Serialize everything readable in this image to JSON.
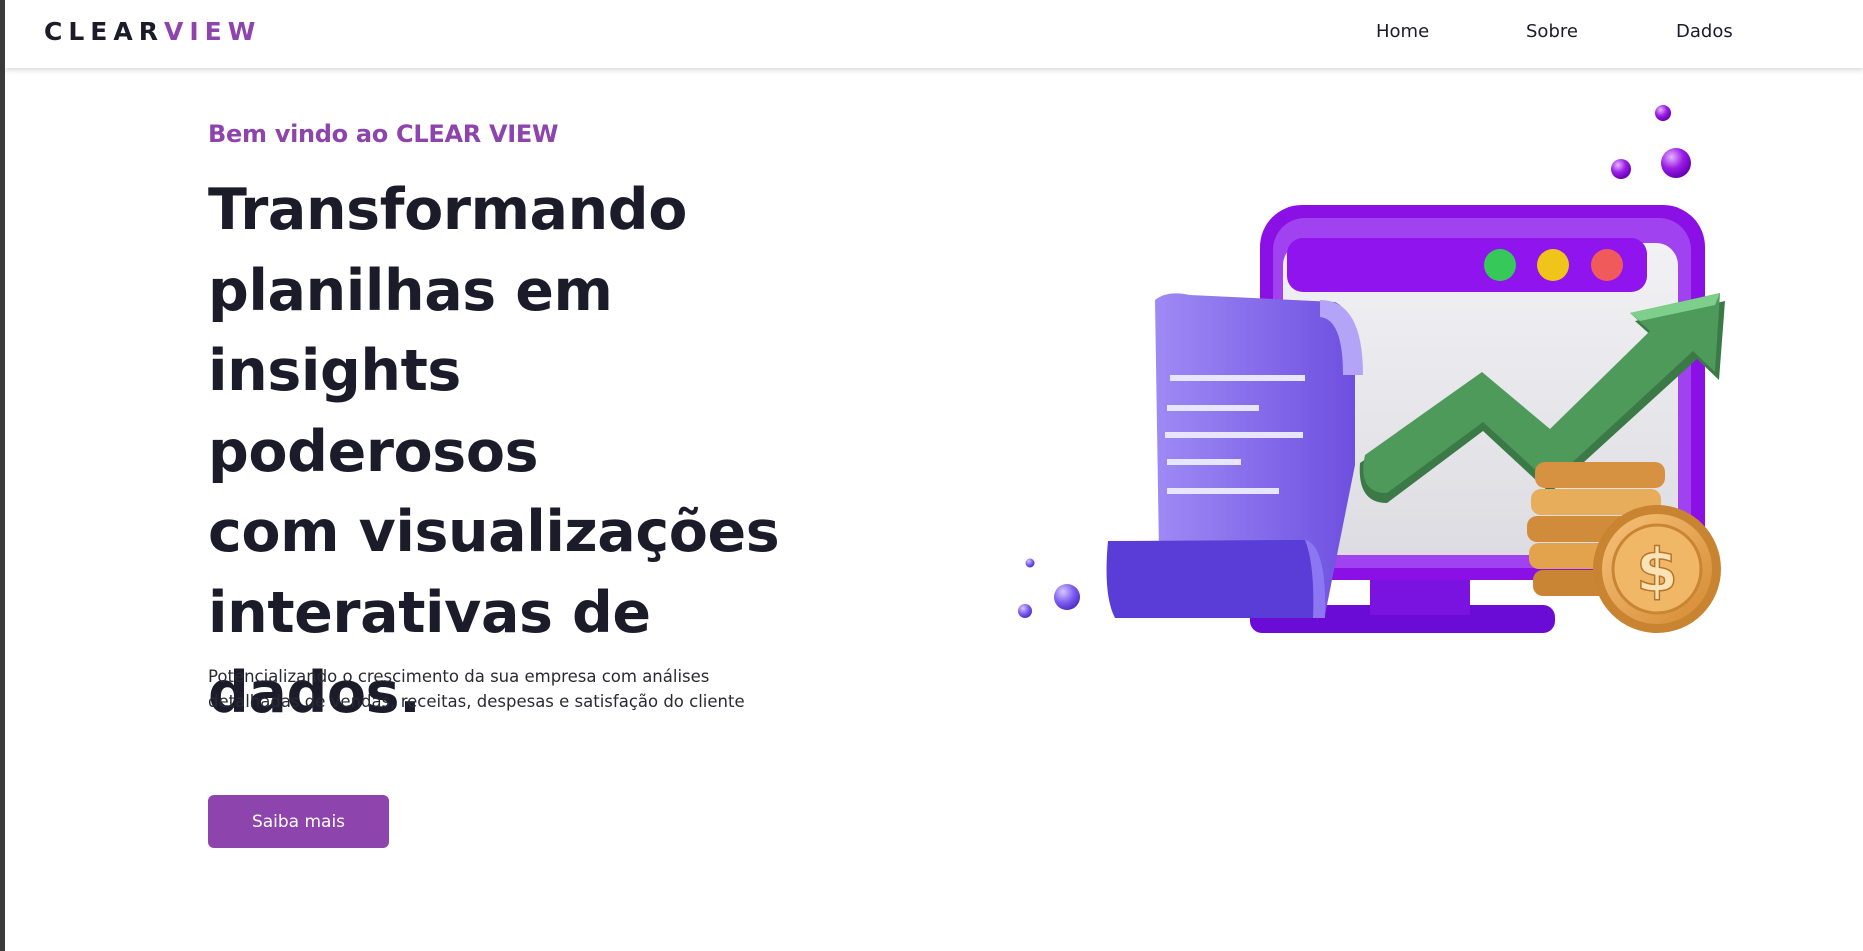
{
  "header": {
    "logo_main": "CLEAR",
    "logo_accent": "VIEW",
    "nav": [
      "Home",
      "Sobre",
      "Dados"
    ]
  },
  "hero": {
    "subtitle": "Bem vindo ao CLEAR VIEW",
    "title_lines": [
      "Transformando",
      "planilhas em",
      "insights poderosos",
      "com visualizações",
      "interativas de",
      "dados."
    ],
    "description_lines": [
      "Potencializando o crescimento da sua empresa com análises",
      "detalhadas de vendas, receitas, despesas e satisfação do cliente"
    ],
    "cta_label": "Saiba mais"
  },
  "illustration": {
    "icons": [
      "monitor-icon",
      "receipt-icon",
      "growth-arrow-icon",
      "dollar-coin-icon"
    ],
    "dollar_sign": "$",
    "colors": {
      "accent": "#8e44ad",
      "monitor": "#8a10e6",
      "arrow": "#4e9a5a",
      "coin": "#e3a24c",
      "receipt": "#7b5ce6"
    }
  }
}
